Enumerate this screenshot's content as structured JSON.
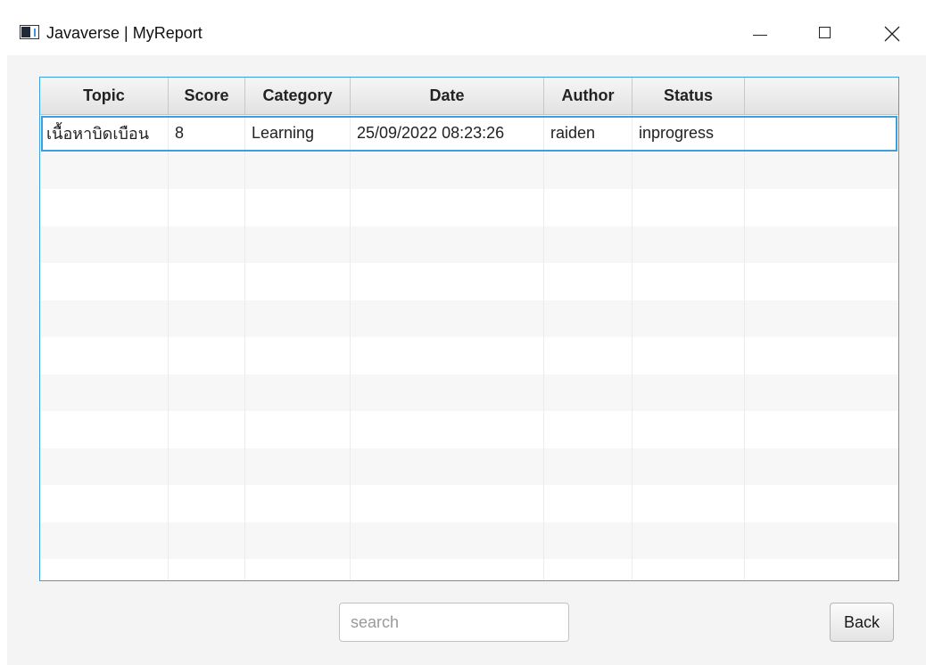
{
  "window": {
    "title": "Javaverse | MyReport",
    "icon": "javafx-window-icon",
    "controls": [
      "minimize-icon",
      "maximize-icon",
      "close-icon"
    ]
  },
  "table": {
    "columns": [
      "Topic",
      "Score",
      "Category",
      "Date",
      "Author",
      "Status",
      ""
    ],
    "rows": [
      [
        "เนื้อหาบิดเบือน",
        "8",
        "Learning",
        "25/09/2022 08:23:26",
        "raiden",
        "inprogress",
        ""
      ]
    ],
    "selected_row": 0
  },
  "search": {
    "placeholder": "search",
    "value": ""
  },
  "back_label": "Back",
  "colors": {
    "accent": "#3ba0dd",
    "background": "#f4f4f4"
  }
}
